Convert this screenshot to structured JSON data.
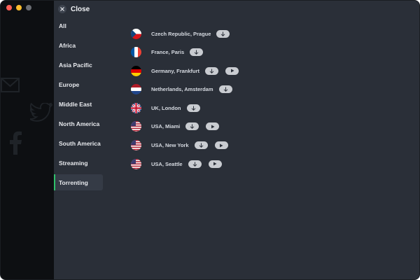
{
  "window": {
    "traffic_lights": [
      "close",
      "minimize",
      "zoom"
    ],
    "colors": {
      "background": "#2a2f38",
      "sidebar": "#0d0f12",
      "accent": "#2fc06a"
    }
  },
  "header": {
    "close_label": "Close",
    "close_icon": "close-icon"
  },
  "background_icons": [
    "mail-icon",
    "twitter-icon",
    "facebook-icon"
  ],
  "categories": [
    {
      "label": "All",
      "active": false
    },
    {
      "label": "Africa",
      "active": false
    },
    {
      "label": "Asia Pacific",
      "active": false
    },
    {
      "label": "Europe",
      "active": false
    },
    {
      "label": "Middle East",
      "active": false
    },
    {
      "label": "North America",
      "active": false
    },
    {
      "label": "South America",
      "active": false
    },
    {
      "label": "Streaming",
      "active": false
    },
    {
      "label": "Torrenting",
      "active": true
    }
  ],
  "servers": [
    {
      "name": "Czech Republic, Prague",
      "flag": "czech-flag-icon",
      "badges": [
        "download-icon"
      ]
    },
    {
      "name": "France, Paris",
      "flag": "france-flag-icon",
      "badges": [
        "download-icon"
      ]
    },
    {
      "name": "Germany, Frankfurt",
      "flag": "germany-flag-icon",
      "badges": [
        "download-icon",
        "play-icon"
      ]
    },
    {
      "name": "Netherlands, Amsterdam",
      "flag": "netherlands-flag-icon",
      "badges": [
        "download-icon"
      ]
    },
    {
      "name": "UK, London",
      "flag": "uk-flag-icon",
      "badges": [
        "download-icon"
      ]
    },
    {
      "name": "USA, Miami",
      "flag": "usa-flag-icon",
      "badges": [
        "download-icon",
        "play-icon"
      ]
    },
    {
      "name": "USA, New York",
      "flag": "usa-flag-icon",
      "badges": [
        "download-icon",
        "play-icon"
      ]
    },
    {
      "name": "USA, Seattle",
      "flag": "usa-flag-icon",
      "badges": [
        "download-icon",
        "play-icon"
      ]
    }
  ]
}
